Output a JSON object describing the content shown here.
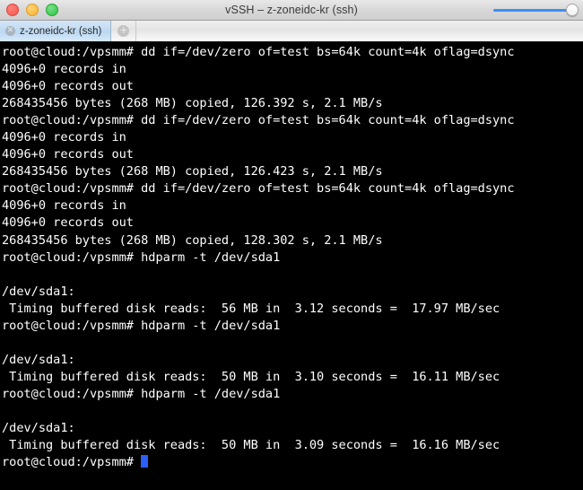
{
  "window": {
    "title": "vSSH – z-zoneidc-kr (ssh)",
    "traffic_lights": {
      "close_label": "",
      "minimize_label": "",
      "maximize_label": ""
    },
    "zoom_slider": {
      "value": 100,
      "accent_color": "#3b90f5"
    }
  },
  "tabbar": {
    "tabs": [
      {
        "label": "z-zoneidc-kr (ssh)",
        "close_glyph": "✕",
        "active": true
      }
    ],
    "add_tab_glyph": "+"
  },
  "terminal": {
    "colors": {
      "background": "#000000",
      "foreground": "#ffffff",
      "cursor": "#2b5df7"
    },
    "prompt": "root@cloud:/vpsmm#",
    "lines": [
      "root@cloud:/vpsmm# dd if=/dev/zero of=test bs=64k count=4k oflag=dsync",
      "4096+0 records in",
      "4096+0 records out",
      "268435456 bytes (268 MB) copied, 126.392 s, 2.1 MB/s",
      "root@cloud:/vpsmm# dd if=/dev/zero of=test bs=64k count=4k oflag=dsync",
      "4096+0 records in",
      "4096+0 records out",
      "268435456 bytes (268 MB) copied, 126.423 s, 2.1 MB/s",
      "root@cloud:/vpsmm# dd if=/dev/zero of=test bs=64k count=4k oflag=dsync",
      "4096+0 records in",
      "4096+0 records out",
      "268435456 bytes (268 MB) copied, 128.302 s, 2.1 MB/s",
      "root@cloud:/vpsmm# hdparm -t /dev/sda1",
      "",
      "/dev/sda1:",
      " Timing buffered disk reads:  56 MB in  3.12 seconds =  17.97 MB/sec",
      "root@cloud:/vpsmm# hdparm -t /dev/sda1",
      "",
      "/dev/sda1:",
      " Timing buffered disk reads:  50 MB in  3.10 seconds =  16.11 MB/sec",
      "root@cloud:/vpsmm# hdparm -t /dev/sda1",
      "",
      "/dev/sda1:",
      " Timing buffered disk reads:  50 MB in  3.09 seconds =  16.16 MB/sec"
    ],
    "current_prompt": "root@cloud:/vpsmm# "
  }
}
